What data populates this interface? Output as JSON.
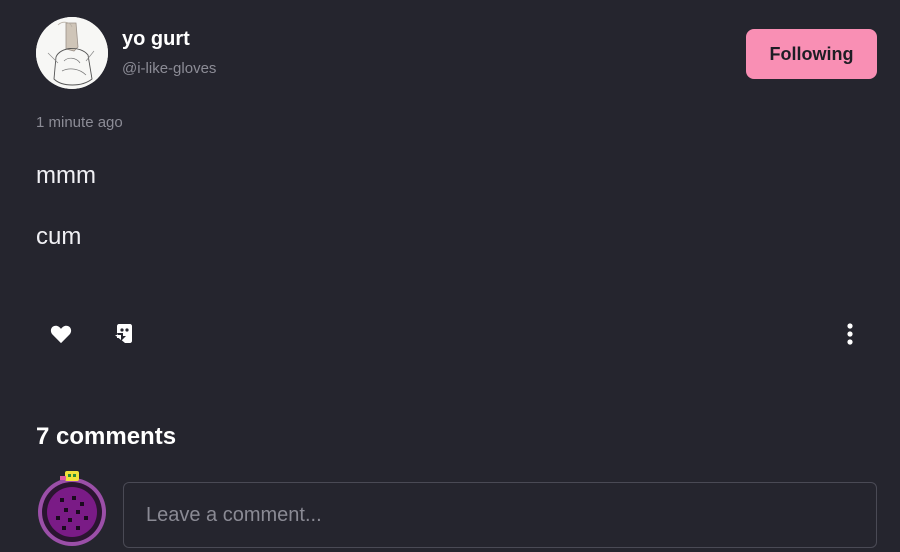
{
  "author": {
    "name": "yo gurt",
    "handle": "@i-like-gloves"
  },
  "follow_button": {
    "label": "Following",
    "color": "#f98fb4"
  },
  "post": {
    "timestamp": "1 minute ago",
    "lines": [
      "mmm",
      "cum"
    ]
  },
  "actions": {
    "like_icon": "heart-icon",
    "reblog_icon": "reblog-icon",
    "more_icon": "more-vertical-icon"
  },
  "comments": {
    "count_label": "7 comments",
    "input_placeholder": "Leave a comment..."
  },
  "colors": {
    "background": "#25252e",
    "text": "#ffffff",
    "muted": "#8c8c96",
    "accent": "#f98fb4"
  }
}
